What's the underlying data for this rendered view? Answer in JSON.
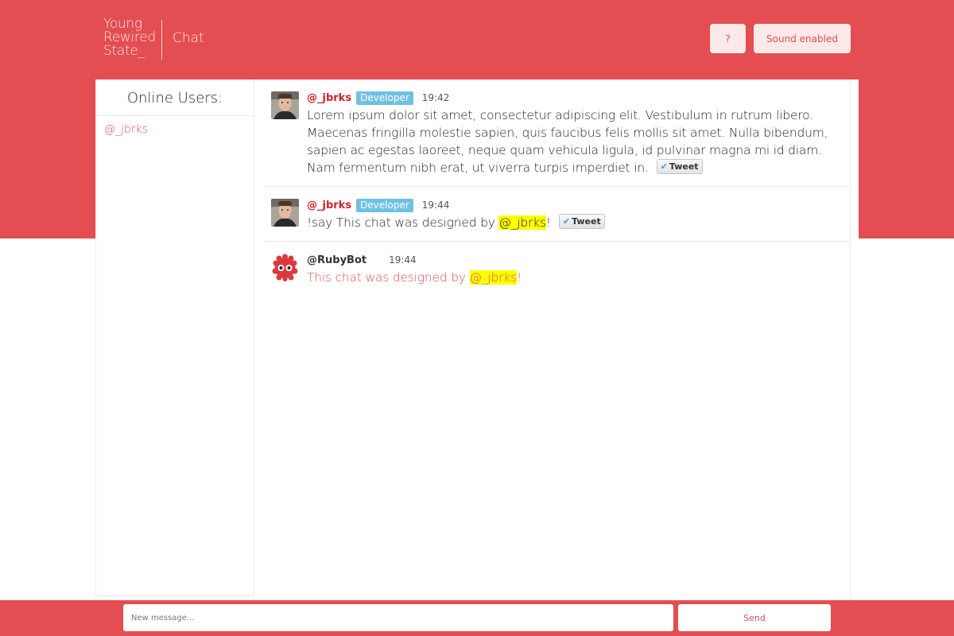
{
  "header": {
    "logo_lines": [
      "Young",
      "Rewired",
      "State_"
    ],
    "app_title": "Chat",
    "help_label": "?",
    "sound_label": "Sound enabled"
  },
  "sidebar": {
    "title": "Online Users:",
    "users": [
      "@_jbrks"
    ]
  },
  "messages": [
    {
      "username": "@_jbrks",
      "role": "Developer",
      "time": "19:42",
      "text": "Lorem ipsum dolor sit amet, consectetur adipiscing elit. Vestibulum in rutrum libero. Maecenas fringilla molestie sapien, quis faucibus felis mollis sit amet. Nulla bibendum, sapien ac egestas laoreet, neque quam vehicula ligula, id pulvinar magna mi id diam. Nam fermentum nibh erat, ut viverra turpis imperdiet in.",
      "tweet_label": "Tweet"
    },
    {
      "username": "@_jbrks",
      "role": "Developer",
      "time": "19:44",
      "text_before": "!say This chat was designed by ",
      "mention": "@_jbrks",
      "text_after": "!",
      "tweet_label": "Tweet"
    },
    {
      "username": "@RubyBot",
      "time": "19:44",
      "text_before": "This chat was designed by ",
      "mention": "@_jbrks",
      "text_after": "!"
    }
  ],
  "composer": {
    "placeholder": "New message...",
    "send_label": "Send"
  },
  "colors": {
    "brand_red": "#e44d51",
    "badge_blue": "#6fc1e3",
    "mention_highlight": "#ffff00"
  },
  "icons": {
    "avatar_user": "user-photo-avatar",
    "avatar_bot": "red-monster-avatar",
    "tweet": "twitter-bird-icon"
  }
}
